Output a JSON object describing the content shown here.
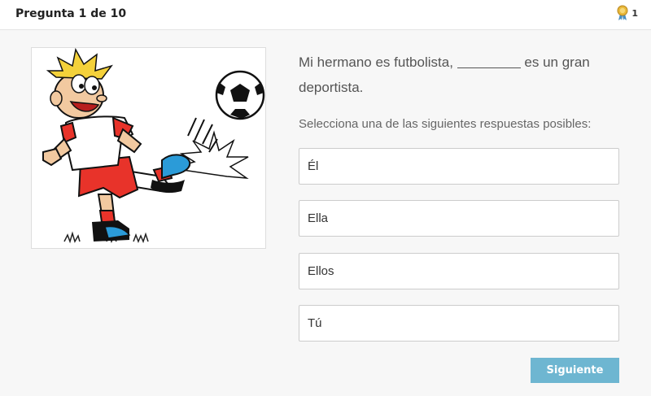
{
  "header": {
    "title": "Pregunta 1 de 10",
    "score": "1",
    "score_icon": "award-ribbon-icon"
  },
  "question": {
    "before_blank": "Mi hermano es futbolista,",
    "after_blank": "es un gran deportista."
  },
  "instruction": "Selecciona una de las siguientes respuestas posibles:",
  "options": [
    {
      "label": "Él"
    },
    {
      "label": "Ella"
    },
    {
      "label": "Ellos"
    },
    {
      "label": "Tú"
    }
  ],
  "next_button": {
    "label": "Siguiente"
  },
  "colors": {
    "accent": "#6eb6d1",
    "page_bg": "#f7f7f7"
  }
}
